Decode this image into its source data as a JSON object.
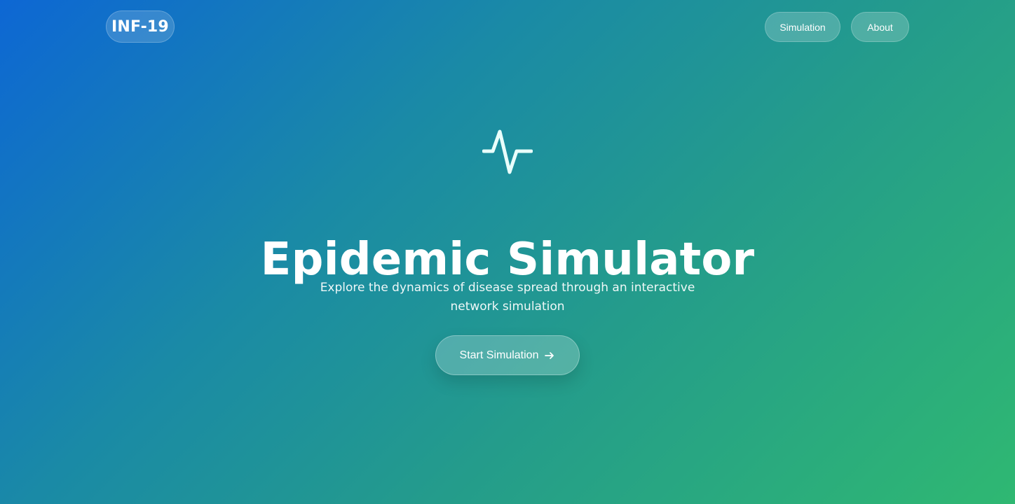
{
  "nav": {
    "brand": "INF-19",
    "links": {
      "simulation": "Simulation",
      "about": "About"
    }
  },
  "hero": {
    "icon": "activity-icon",
    "title": "Epidemic Simulator",
    "subtitle": "Explore the dynamics of disease spread through an interactive network simulation",
    "cta": {
      "label": "Start Simulation",
      "icon": "arrow-right-icon"
    }
  },
  "theme": {
    "gradient_start": "#0d67d4",
    "gradient_end": "#2fb872",
    "text": "#ffffff"
  }
}
